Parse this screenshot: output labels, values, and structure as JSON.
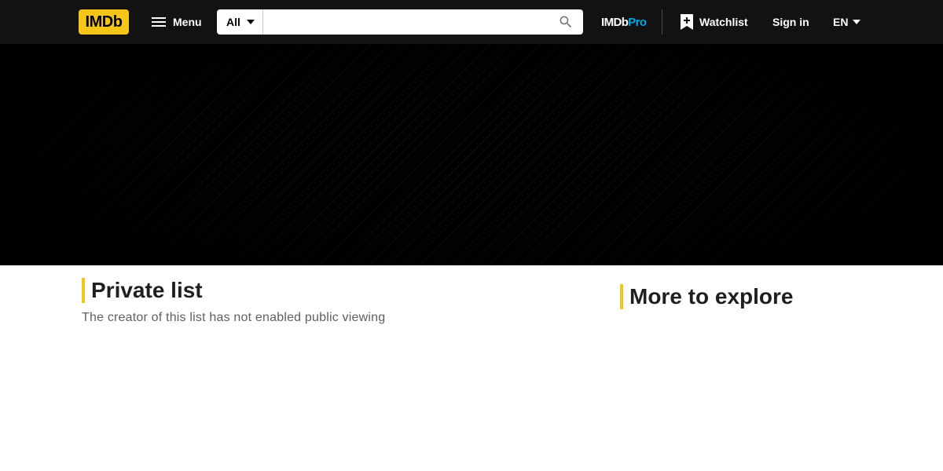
{
  "header": {
    "logo_text": "IMDb",
    "menu_label": "Menu",
    "search": {
      "category": "All",
      "placeholder": ""
    },
    "pro_label_a": "IMDb",
    "pro_label_b": "Pro",
    "watchlist_label": "Watchlist",
    "signin_label": "Sign in",
    "language": "EN"
  },
  "main": {
    "title": "Private list",
    "description": "The creator of this list has not enabled public viewing"
  },
  "sidebar": {
    "title": "More to explore"
  },
  "colors": {
    "brand_yellow": "#f5c518",
    "nav_bg": "#121212",
    "pro_blue": "#00a8e1"
  },
  "icons": [
    "menu-icon",
    "chevron-down-icon",
    "search-icon",
    "bookmark-plus-icon"
  ]
}
